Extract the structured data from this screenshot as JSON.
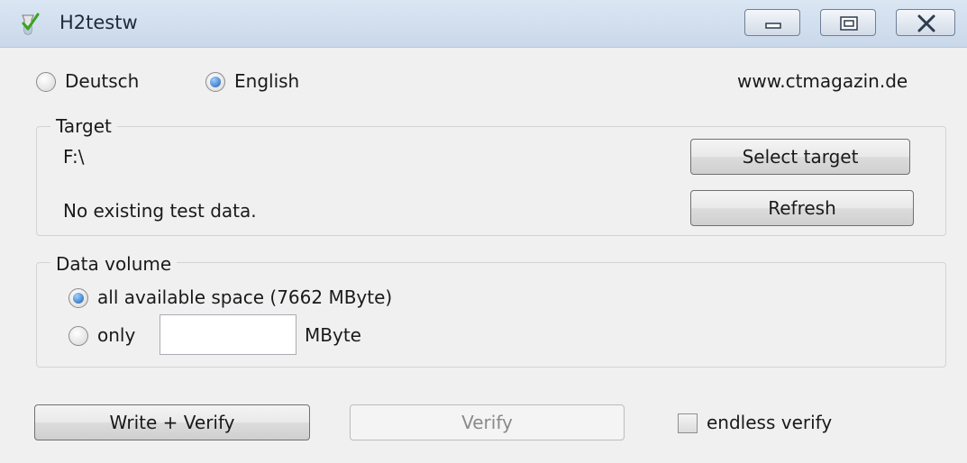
{
  "window": {
    "title": "H2testw",
    "controls": {
      "minimize": "minimize",
      "maximize": "maximize",
      "close": "close"
    }
  },
  "language": {
    "options": [
      {
        "label": "Deutsch",
        "selected": false
      },
      {
        "label": "English",
        "selected": true
      }
    ],
    "website": "www.ctmagazin.de"
  },
  "target": {
    "legend": "Target",
    "path": "F:\\",
    "status": "No existing test data.",
    "select_button": "Select target",
    "refresh_button": "Refresh"
  },
  "data_volume": {
    "legend": "Data volume",
    "all_label": "all available space (7662 MByte)",
    "all_selected": true,
    "only_label": "only",
    "only_value": "",
    "unit": "MByte"
  },
  "actions": {
    "write_verify": "Write + Verify",
    "verify": "Verify",
    "verify_enabled": false,
    "endless_verify_label": "endless verify",
    "endless_verify_checked": false
  }
}
